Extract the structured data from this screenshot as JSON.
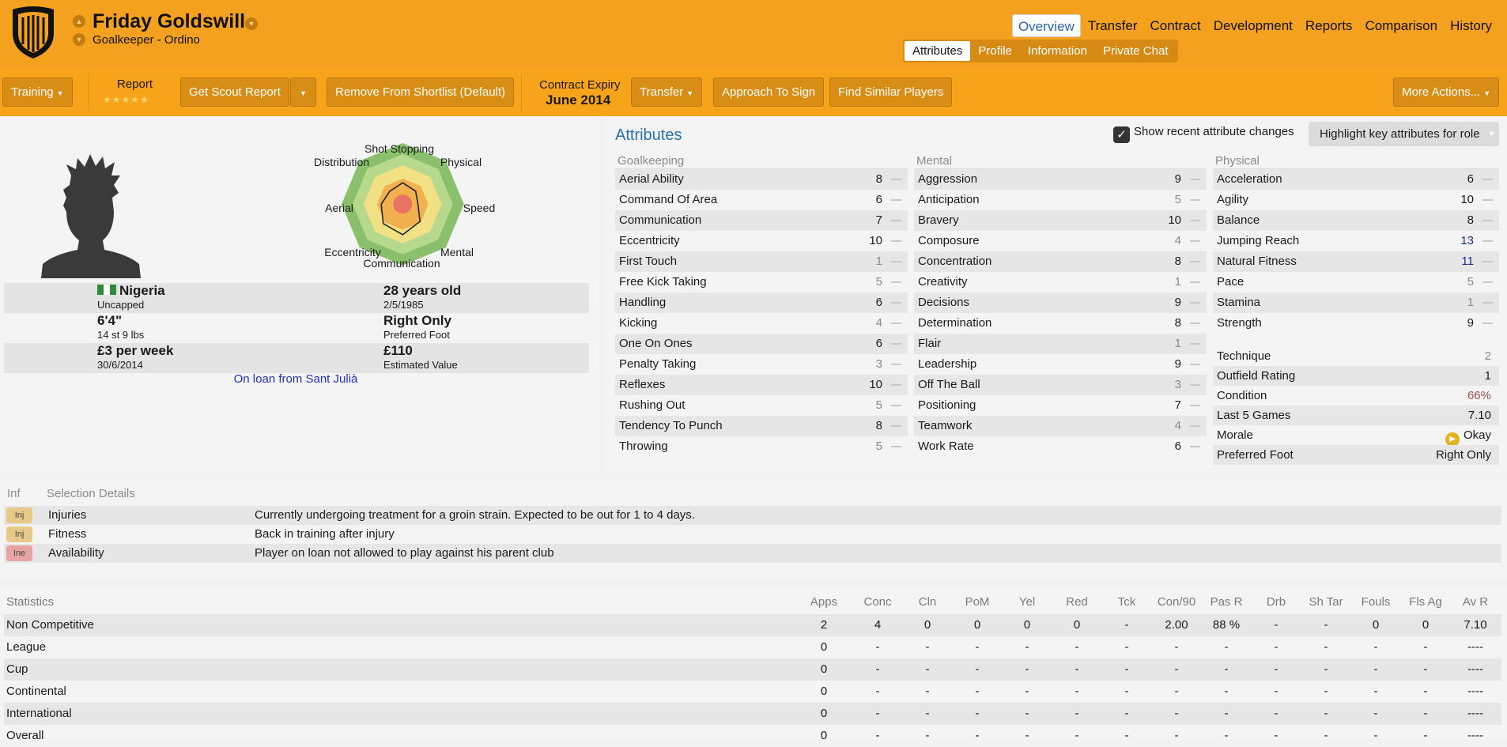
{
  "header": {
    "player_name": "Friday Goldswill",
    "subtitle": "Goalkeeper - Ordino",
    "nav": [
      "Overview",
      "Transfer",
      "Contract",
      "Development",
      "Reports",
      "Comparison",
      "History"
    ],
    "subnav": [
      "Attributes",
      "Profile",
      "Information",
      "Private Chat"
    ]
  },
  "toolbar": {
    "training": "Training",
    "report_label": "Report",
    "report_stars": "★★★★★",
    "scout": "Get Scout Report",
    "shortlist": "Remove From Shortlist (Default)",
    "contract_label": "Contract Expiry",
    "contract_value": "June 2014",
    "transfer": "Transfer",
    "approach": "Approach To Sign",
    "similar": "Find Similar Players",
    "more": "More Actions..."
  },
  "radar": {
    "labels": [
      "Shot Stopping",
      "Physical",
      "Speed",
      "Mental",
      "Communication",
      "Eccentricity",
      "Aerial",
      "Distribution"
    ],
    "values": [
      0.35,
      0.3,
      0.25,
      0.4,
      0.5,
      0.45,
      0.35,
      0.3
    ]
  },
  "facts": {
    "nation": "Nigeria",
    "caps": "Uncapped",
    "age": "28 years old",
    "dob": "2/5/1985",
    "height": "6'4\"",
    "weight": "14 st 9 lbs",
    "foot": "Right Only",
    "foot_label": "Preferred Foot",
    "wage": "£3 per week",
    "wage_date": "30/6/2014",
    "value": "£110",
    "value_label": "Estimated Value",
    "loan": "On loan from Sant Julià"
  },
  "attributes": {
    "title": "Attributes",
    "show_changes": "Show recent attribute changes",
    "highlight": "Highlight key attributes for role",
    "groups": [
      {
        "name": "Goalkeeping",
        "items": [
          {
            "label": "Aerial Ability",
            "value": "8",
            "color": "#1a1a1a"
          },
          {
            "label": "Command Of Area",
            "value": "6",
            "color": "#1a1a1a"
          },
          {
            "label": "Communication",
            "value": "7",
            "color": "#1a1a1a"
          },
          {
            "label": "Eccentricity",
            "value": "10",
            "color": "#1a1a1a"
          },
          {
            "label": "First Touch",
            "value": "1",
            "color": "#888888"
          },
          {
            "label": "Free Kick Taking",
            "value": "5",
            "color": "#888888"
          },
          {
            "label": "Handling",
            "value": "6",
            "color": "#1a1a1a"
          },
          {
            "label": "Kicking",
            "value": "4",
            "color": "#888888"
          },
          {
            "label": "One On Ones",
            "value": "6",
            "color": "#1a1a1a"
          },
          {
            "label": "Penalty Taking",
            "value": "3",
            "color": "#888888"
          },
          {
            "label": "Reflexes",
            "value": "10",
            "color": "#1a1a1a"
          },
          {
            "label": "Rushing Out",
            "value": "5",
            "color": "#888888"
          },
          {
            "label": "Tendency To Punch",
            "value": "8",
            "color": "#1a1a1a"
          },
          {
            "label": "Throwing",
            "value": "5",
            "color": "#888888"
          }
        ]
      },
      {
        "name": "Mental",
        "items": [
          {
            "label": "Aggression",
            "value": "9",
            "color": "#1a1a1a"
          },
          {
            "label": "Anticipation",
            "value": "5",
            "color": "#888888"
          },
          {
            "label": "Bravery",
            "value": "10",
            "color": "#1a1a1a"
          },
          {
            "label": "Composure",
            "value": "4",
            "color": "#888888"
          },
          {
            "label": "Concentration",
            "value": "8",
            "color": "#1a1a1a"
          },
          {
            "label": "Creativity",
            "value": "1",
            "color": "#888888"
          },
          {
            "label": "Decisions",
            "value": "9",
            "color": "#1a1a1a"
          },
          {
            "label": "Determination",
            "value": "8",
            "color": "#1a1a1a"
          },
          {
            "label": "Flair",
            "value": "1",
            "color": "#888888"
          },
          {
            "label": "Leadership",
            "value": "9",
            "color": "#1a1a1a"
          },
          {
            "label": "Off The Ball",
            "value": "3",
            "color": "#888888"
          },
          {
            "label": "Positioning",
            "value": "7",
            "color": "#1a1a1a"
          },
          {
            "label": "Teamwork",
            "value": "4",
            "color": "#888888"
          },
          {
            "label": "Work Rate",
            "value": "6",
            "color": "#1a1a1a"
          }
        ]
      },
      {
        "name": "Physical",
        "items": [
          {
            "label": "Acceleration",
            "value": "6",
            "color": "#1a1a1a"
          },
          {
            "label": "Agility",
            "value": "10",
            "color": "#1a1a1a"
          },
          {
            "label": "Balance",
            "value": "8",
            "color": "#1a1a1a"
          },
          {
            "label": "Jumping Reach",
            "value": "13",
            "color": "#1c2a8a"
          },
          {
            "label": "Natural Fitness",
            "value": "11",
            "color": "#1c2a8a"
          },
          {
            "label": "Pace",
            "value": "5",
            "color": "#888888"
          },
          {
            "label": "Stamina",
            "value": "1",
            "color": "#888888"
          },
          {
            "label": "Strength",
            "value": "9",
            "color": "#1a1a1a"
          }
        ]
      }
    ],
    "extra": [
      {
        "label": "Technique",
        "value": "2",
        "color": "#888888"
      },
      {
        "label": "Outfield Rating",
        "value": "1",
        "color": "#1a1a1a"
      },
      {
        "label": "Condition",
        "value": "66%",
        "color": "#a0524a"
      },
      {
        "label": "Last 5 Games",
        "value": "7.10",
        "color": "#1a1a1a"
      },
      {
        "label": "Morale",
        "value": "Okay",
        "color": "#1a1a1a"
      },
      {
        "label": "Preferred Foot",
        "value": "Right Only",
        "color": "#1a1a1a"
      }
    ]
  },
  "selection": {
    "head_inf": "Inf",
    "head_title": "Selection Details",
    "rows": [
      {
        "tag": "Inj",
        "tag_color": "#e7c98a",
        "label": "Injuries",
        "detail": "Currently undergoing treatment for a groin strain. Expected to be out for 1 to 4 days."
      },
      {
        "tag": "Inj",
        "tag_color": "#e7c98a",
        "label": "Fitness",
        "detail": "Back in training after injury"
      },
      {
        "tag": "Ine",
        "tag_color": "#e8a3a3",
        "label": "Availability",
        "detail": "Player on loan not allowed to play against his parent club"
      }
    ]
  },
  "statistics": {
    "title": "Statistics",
    "columns": [
      "Apps",
      "Conc",
      "Cln",
      "PoM",
      "Yel",
      "Red",
      "Tck",
      "Con/90",
      "Pas R",
      "Drb",
      "Sh Tar",
      "Fouls",
      "Fls Ag",
      "Av R"
    ],
    "rows": [
      {
        "label": "Non Competitive",
        "cells": [
          "2",
          "4",
          "0",
          "0",
          "0",
          "0",
          "-",
          "2.00",
          "88 %",
          "-",
          "-",
          "0",
          "0",
          "7.10"
        ]
      },
      {
        "label": "League",
        "cells": [
          "0",
          "-",
          "-",
          "-",
          "-",
          "-",
          "-",
          "-",
          "-",
          "-",
          "-",
          "-",
          "-",
          "----"
        ]
      },
      {
        "label": "Cup",
        "cells": [
          "0",
          "-",
          "-",
          "-",
          "-",
          "-",
          "-",
          "-",
          "-",
          "-",
          "-",
          "-",
          "-",
          "----"
        ]
      },
      {
        "label": "Continental",
        "cells": [
          "0",
          "-",
          "-",
          "-",
          "-",
          "-",
          "-",
          "-",
          "-",
          "-",
          "-",
          "-",
          "-",
          "----"
        ]
      },
      {
        "label": "International",
        "cells": [
          "0",
          "-",
          "-",
          "-",
          "-",
          "-",
          "-",
          "-",
          "-",
          "-",
          "-",
          "-",
          "-",
          "----"
        ]
      },
      {
        "label": "Overall",
        "cells": [
          "0",
          "-",
          "-",
          "-",
          "-",
          "-",
          "-",
          "-",
          "-",
          "-",
          "-",
          "-",
          "-",
          "----"
        ]
      }
    ]
  }
}
